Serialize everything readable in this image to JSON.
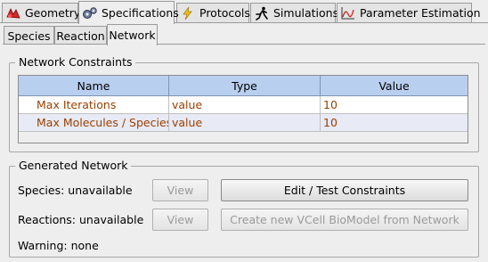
{
  "top_tabs": [
    {
      "label": "Geometry",
      "icon": "geometry-icon"
    },
    {
      "label": "Specifications",
      "icon": "gears-icon"
    },
    {
      "label": "Protocols",
      "icon": "lightning-icon"
    },
    {
      "label": "Simulations",
      "icon": "runner-icon"
    },
    {
      "label": "Parameter Estimation",
      "icon": "chart-icon"
    }
  ],
  "sub_tabs": [
    "Species",
    "Reaction",
    "Network"
  ],
  "network_constraints": {
    "title": "Network Constraints",
    "columns": [
      "Name",
      "Type",
      "Value"
    ],
    "rows": [
      {
        "name": "Max Iterations",
        "type": "value",
        "value": "10"
      },
      {
        "name": "Max Molecules / Species",
        "type": "value",
        "value": "10"
      }
    ]
  },
  "generated_network": {
    "title": "Generated Network",
    "species_label": "Species: unavailable",
    "reactions_label": "Reactions: unavailable",
    "warning_label": "Warning: none",
    "view_label": "View",
    "edit_button": "Edit / Test Constraints",
    "create_button": "Create new VCell BioModel from Network"
  },
  "colors": {
    "header_bg": "#b9cff0",
    "value_text": "#9b3f00",
    "alt_row": "#e8eaf5"
  }
}
